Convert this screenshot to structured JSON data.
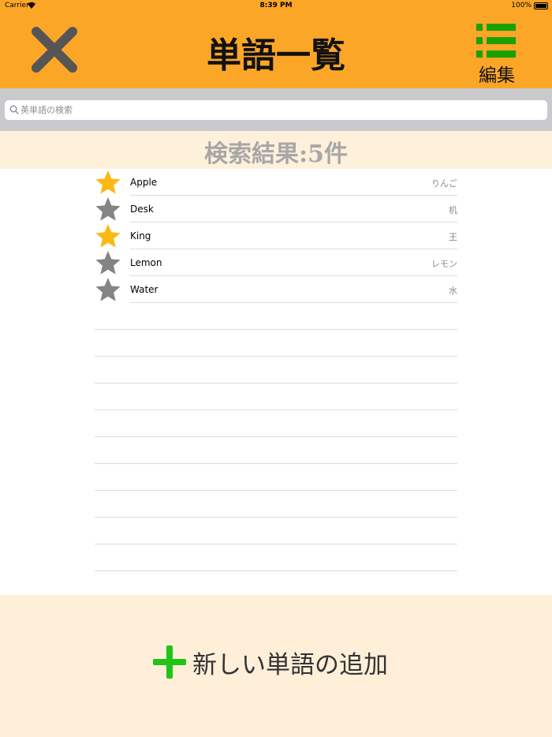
{
  "status_bar": {
    "carrier": "Carrier",
    "time": "8:39 PM",
    "battery": "100%"
  },
  "header": {
    "title": "単語一覧",
    "close_icon": "close-x-icon",
    "edit_icon": "list-icon",
    "edit_label": "編集",
    "accent_color": "#fca628",
    "edit_icon_color": "#1aa000"
  },
  "search": {
    "placeholder": "英単語の検索",
    "value": ""
  },
  "results": {
    "count_label": "検索結果:5件"
  },
  "words": [
    {
      "english": "Apple",
      "japanese": "りんご",
      "starred": true
    },
    {
      "english": "Desk",
      "japanese": "机",
      "starred": false
    },
    {
      "english": "King",
      "japanese": "王",
      "starred": true
    },
    {
      "english": "Lemon",
      "japanese": "レモン",
      "starred": false
    },
    {
      "english": "Water",
      "japanese": "水",
      "starred": false
    }
  ],
  "colors": {
    "star_on": "#fcb914",
    "star_off": "#848484",
    "plus": "#22c418"
  },
  "footer": {
    "add_label": "新しい単語の追加",
    "add_icon": "plus-icon"
  }
}
